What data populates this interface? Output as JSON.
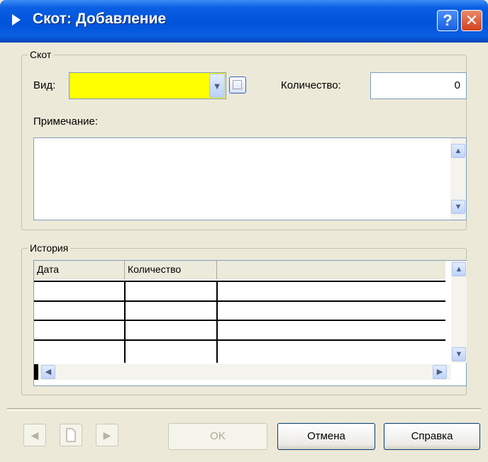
{
  "window": {
    "title": "Скот: Добавление",
    "help_glyph": "?",
    "close_glyph": "✕"
  },
  "livestock_group": {
    "legend": "Скот",
    "kind_label": "Вид:",
    "kind_value": "",
    "quantity_label": "Количество:",
    "quantity_value": "0",
    "note_label": "Примечание:",
    "note_value": ""
  },
  "history_group": {
    "legend": "История",
    "columns": [
      "Дата",
      "Количество",
      ""
    ],
    "rows": [
      [
        "",
        ""
      ],
      [
        "",
        ""
      ],
      [
        "",
        ""
      ],
      [
        "",
        ""
      ]
    ]
  },
  "footer": {
    "ok_label": "OK",
    "cancel_label": "Отмена",
    "help_label": "Справка"
  },
  "icons": {
    "prev": "◀",
    "next": "▶",
    "up": "▲",
    "down": "▼",
    "left": "◀",
    "right": "▶",
    "dropdown": "▼"
  },
  "colors": {
    "titlebar": "#0153da",
    "kind_field_bg": "#ffff00",
    "window_bg": "#ece9d8"
  }
}
